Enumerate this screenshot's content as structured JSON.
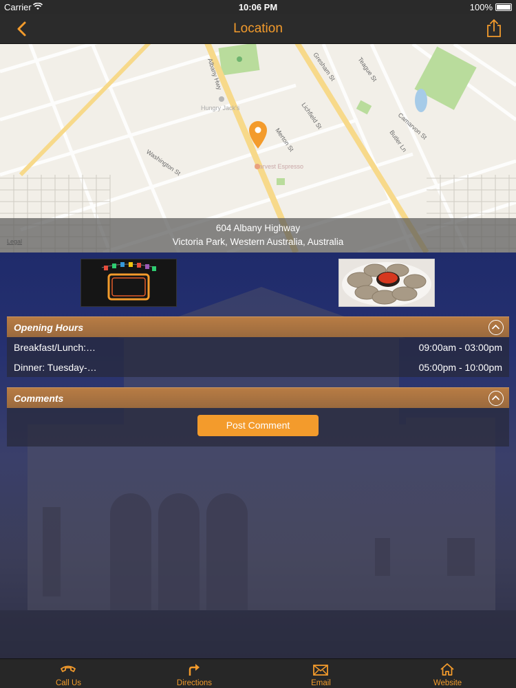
{
  "status_bar": {
    "carrier": "Carrier",
    "time": "10:06 PM",
    "battery": "100%"
  },
  "nav": {
    "title": "Location",
    "back_icon": "chevron-left-icon",
    "share_icon": "share-icon",
    "accent": "#f39b2c"
  },
  "map": {
    "streets": [
      "Albany Hwy",
      "Gresham St",
      "Teague St",
      "Lichfield St",
      "Merton St",
      "Washington St",
      "Camarvon St",
      "Butler Ln",
      "Albany Hwy"
    ],
    "legal": "Legal",
    "address_line1": "604 Albany Highway",
    "address_line2": "Victoria Park, Western Australia, Australia"
  },
  "opening_hours": {
    "title": "Opening Hours",
    "rows": [
      {
        "day": "Breakfast/Lunch:…",
        "time": "09:00am - 03:00pm"
      },
      {
        "day": "Dinner: Tuesday-…",
        "time": "05:00pm - 10:00pm"
      }
    ]
  },
  "comments": {
    "title": "Comments",
    "post_button": "Post Comment"
  },
  "tabs": [
    {
      "label": "Call Us",
      "icon": "phone-icon"
    },
    {
      "label": "Directions",
      "icon": "directions-icon"
    },
    {
      "label": "Email",
      "icon": "email-icon"
    },
    {
      "label": "Website",
      "icon": "home-icon"
    }
  ]
}
